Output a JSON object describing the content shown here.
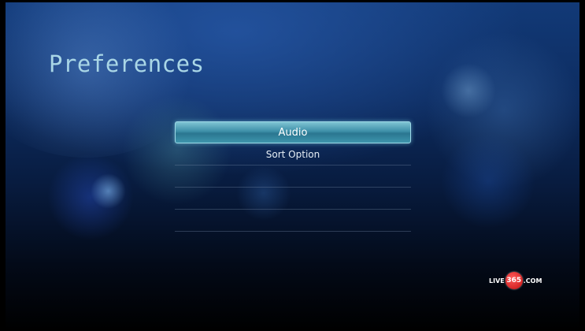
{
  "screen": {
    "title": "Preferences"
  },
  "menu": {
    "items": [
      {
        "label": "Audio",
        "selected": true
      },
      {
        "label": "Sort Option",
        "selected": false
      },
      {
        "label": "",
        "selected": false
      },
      {
        "label": "",
        "selected": false
      },
      {
        "label": "",
        "selected": false
      }
    ]
  },
  "logo": {
    "prefix": "LIVE",
    "number": "365",
    "suffix": ".COM"
  },
  "colors": {
    "title": "#a9d6e6",
    "highlight": "#3d8fa8",
    "logo_red": "#c41010"
  }
}
